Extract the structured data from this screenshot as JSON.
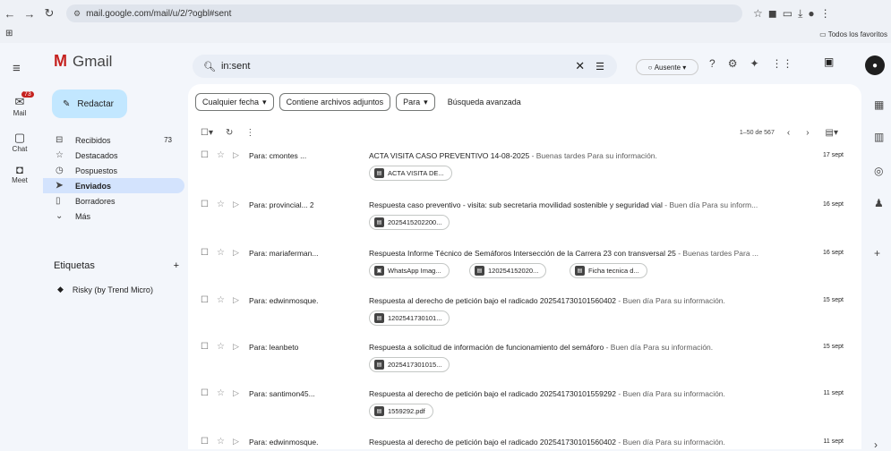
{
  "browser": {
    "url": "mail.google.com/mail/u/2/?ogbl#sent",
    "bookmarks_label": "Todos los favoritos"
  },
  "rail": {
    "mail_label": "Mail",
    "mail_badge": "73",
    "chat_label": "Chat",
    "meet_label": "Meet"
  },
  "app": {
    "title": "Gmail"
  },
  "compose_label": "Redactar",
  "nav": [
    {
      "label": "Recibidos",
      "icon": "inbox-icon",
      "count": "73",
      "active": false
    },
    {
      "label": "Destacados",
      "icon": "star-icon",
      "count": "",
      "active": false
    },
    {
      "label": "Pospuestos",
      "icon": "clock-icon",
      "count": "",
      "active": false
    },
    {
      "label": "Enviados",
      "icon": "send-icon",
      "count": "",
      "active": true
    },
    {
      "label": "Borradores",
      "icon": "draft-icon",
      "count": "",
      "active": false
    },
    {
      "label": "Más",
      "icon": "chevron-down-icon",
      "count": "",
      "active": false
    }
  ],
  "labels": {
    "heading": "Etiquetas",
    "items": [
      {
        "label": "Risky (by Trend Micro)"
      }
    ]
  },
  "search": {
    "value": "in:sent"
  },
  "status_label": "Ausente",
  "filters": {
    "date": "Cualquier fecha",
    "attachments": "Contiene archivos adjuntos",
    "to": "Para",
    "advanced": "Búsqueda avanzada"
  },
  "pager": "1–50 de 567",
  "emails": [
    {
      "to": "Para: cmontes ...",
      "count": "",
      "subject": "ACTA VISITA CASO PREVENTIVO 14-08-2025",
      "preview": " - Buenas tardes Para su información.",
      "date": "17 sept",
      "attachments": [
        "ACTA VISITA DE..."
      ]
    },
    {
      "to": "Para: provincial...",
      "count": "2",
      "subject": "Respuesta caso preventivo - visita: sub secretaria movilidad sostenible y seguridad vial",
      "preview": " - Buen día Para su inform...",
      "date": "16 sept",
      "attachments": [
        "2025415202200..."
      ]
    },
    {
      "to": "Para: mariaferman...",
      "count": "",
      "subject": "Respuesta Informe Técnico de Semáforos Intersección de la Carrera 23 con transversal 25",
      "preview": " - Buenas tardes Para ...",
      "date": "16 sept",
      "attachments": [
        "WhatsApp Imag...",
        "120254152020...",
        "Ficha tecnica d..."
      ]
    },
    {
      "to": "Para: edwinmosque.",
      "count": "",
      "subject": "Respuesta al derecho de petición bajo el radicado 20254173010156040​2",
      "preview": " - Buen día Para su información.",
      "date": "15 sept",
      "attachments": [
        "120254173010​1..."
      ]
    },
    {
      "to": "Para: leanbeto",
      "count": "",
      "subject": "Respuesta a solicitud de información de funcionamiento del semáforo",
      "preview": " - Buen día Para su información.",
      "date": "15 sept",
      "attachments": [
        "2025417301015..."
      ]
    },
    {
      "to": "Para: santimon45...",
      "count": "",
      "subject": "Respuesta al derecho de petición bajo el radicado 20254173010155929​2",
      "preview": " - Buen día Para su información.",
      "date": "11 sept",
      "attachments": [
        "1559292.pdf"
      ]
    },
    {
      "to": "Para: edwinmosque.",
      "count": "",
      "subject": "Respuesta al derecho de petición bajo el radicado 202541730101560402",
      "preview": " - Buen día Para su información.",
      "date": "11 sept",
      "attachments": []
    }
  ]
}
